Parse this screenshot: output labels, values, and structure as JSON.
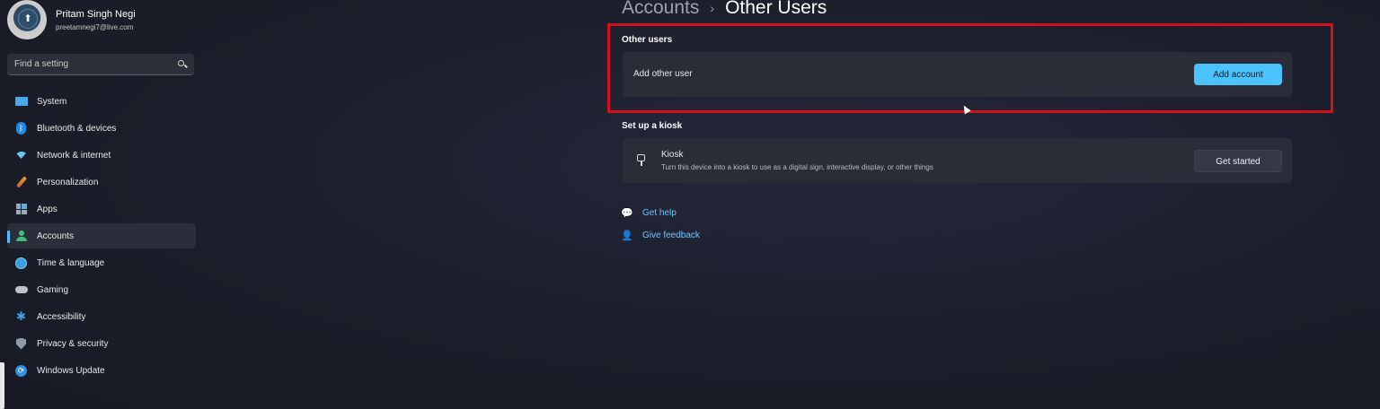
{
  "profile": {
    "name": "Pritam Singh Negi",
    "email": "preetamnegi7@live.com"
  },
  "search": {
    "placeholder": "Find a setting"
  },
  "sidebar": {
    "items": [
      {
        "label": "System",
        "icon": "system-icon"
      },
      {
        "label": "Bluetooth & devices",
        "icon": "bluetooth-icon"
      },
      {
        "label": "Network & internet",
        "icon": "wifi-icon"
      },
      {
        "label": "Personalization",
        "icon": "brush-icon"
      },
      {
        "label": "Apps",
        "icon": "apps-icon"
      },
      {
        "label": "Accounts",
        "icon": "account-icon",
        "active": true
      },
      {
        "label": "Time & language",
        "icon": "globe-clock-icon"
      },
      {
        "label": "Gaming",
        "icon": "gamepad-icon"
      },
      {
        "label": "Accessibility",
        "icon": "accessibility-icon"
      },
      {
        "label": "Privacy & security",
        "icon": "shield-icon"
      },
      {
        "label": "Windows Update",
        "icon": "update-icon"
      }
    ]
  },
  "breadcrumb": {
    "parent": "Accounts",
    "separator": "›",
    "current": "Other Users"
  },
  "other_users": {
    "title": "Other users",
    "row_label": "Add other user",
    "button": "Add account"
  },
  "kiosk": {
    "title": "Set up a kiosk",
    "row_title": "Kiosk",
    "row_desc": "Turn this device into a kiosk to use as a digital sign, interactive display, or other things",
    "button": "Get started"
  },
  "links": {
    "help": "Get help",
    "feedback": "Give feedback"
  },
  "colors": {
    "accent": "#4cc2ff",
    "highlight": "#d3111a"
  }
}
